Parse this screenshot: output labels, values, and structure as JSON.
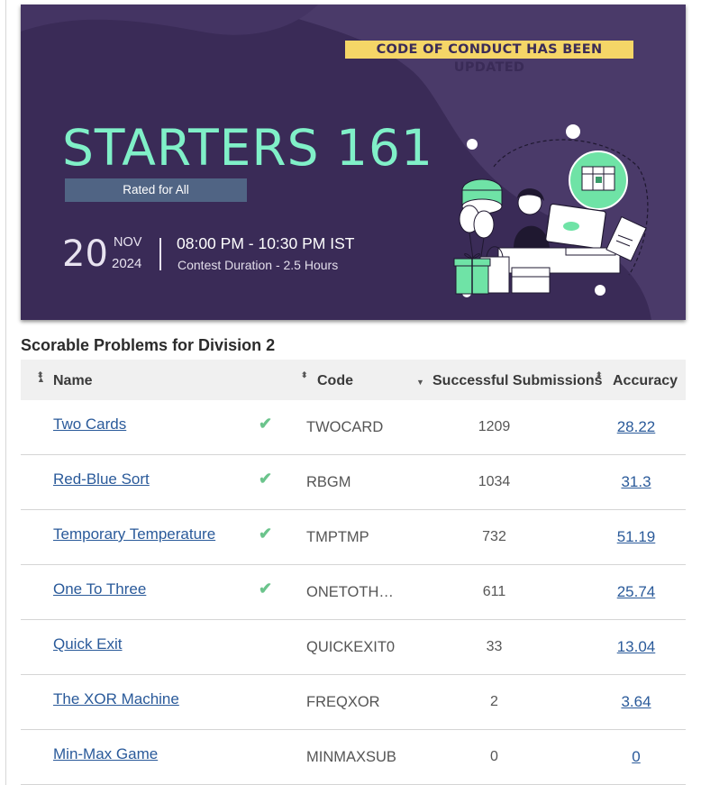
{
  "banner": {
    "notice": "CODE OF CONDUCT HAS BEEN UPDATED",
    "title": "STARTERS 161",
    "rated": "Rated for All",
    "day": "20",
    "month": "NOV",
    "year": "2024",
    "time": "08:00 PM - 10:30 PM IST",
    "duration": "Contest Duration - 2.5 Hours"
  },
  "section_title": "Scorable Problems for Division 2",
  "columns": {
    "name": "Name",
    "code": "Code",
    "submissions": "Successful Submissions",
    "accuracy": "Accuracy"
  },
  "problems": [
    {
      "name": "Two Cards",
      "solved": true,
      "code": "TWOCARD",
      "submissions": "1209",
      "accuracy": "28.22"
    },
    {
      "name": "Red-Blue Sort",
      "solved": true,
      "code": "RBGM",
      "submissions": "1034",
      "accuracy": "31.3"
    },
    {
      "name": "Temporary Temperature",
      "solved": true,
      "code": "TMPTMP",
      "submissions": "732",
      "accuracy": "51.19"
    },
    {
      "name": "One To Three",
      "solved": true,
      "code": "ONETOTH…",
      "submissions": "611",
      "accuracy": "25.74"
    },
    {
      "name": "Quick Exit",
      "solved": false,
      "code": "QUICKEXIT0",
      "submissions": "33",
      "accuracy": "13.04"
    },
    {
      "name": "The XOR Machine",
      "solved": false,
      "code": "FREQXOR",
      "submissions": "2",
      "accuracy": "3.64"
    },
    {
      "name": "Min-Max Game",
      "solved": false,
      "code": "MINMAXSUB",
      "submissions": "0",
      "accuracy": "0"
    }
  ],
  "colors": {
    "banner_bg": "#3a2b57",
    "title": "#80f0c8",
    "notice_bg": "#f5d667",
    "link": "#2a5a9a",
    "check": "#6bc48c"
  }
}
